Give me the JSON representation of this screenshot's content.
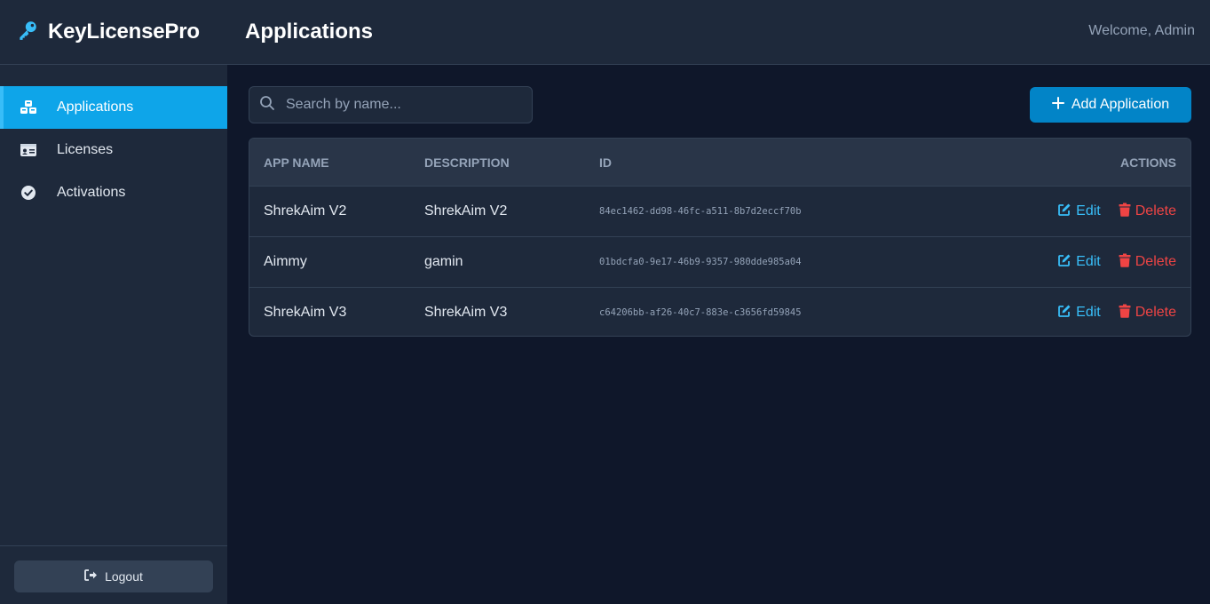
{
  "brand": {
    "name": "KeyLicensePro",
    "icon": "key-icon",
    "accent": "#38bdf8"
  },
  "header": {
    "title": "Applications",
    "welcome": "Welcome, Admin"
  },
  "sidebar": {
    "items": [
      {
        "label": "Applications",
        "icon": "cubes-icon",
        "active": true
      },
      {
        "label": "Licenses",
        "icon": "id-card-icon",
        "active": false
      },
      {
        "label": "Activations",
        "icon": "check-circle-icon",
        "active": false
      }
    ],
    "logout_label": "Logout"
  },
  "search": {
    "placeholder": "Search by name...",
    "value": ""
  },
  "toolbar": {
    "add_label": "Add Application"
  },
  "table": {
    "headers": {
      "name": "APP NAME",
      "description": "DESCRIPTION",
      "id": "ID",
      "actions": "ACTIONS"
    },
    "rows": [
      {
        "name": "ShrekAim V2",
        "description": "ShrekAim V2",
        "id": "84ec1462-dd98-46fc-a511-8b7d2eccf70b",
        "edit": "Edit",
        "delete": "Delete"
      },
      {
        "name": "Aimmy",
        "description": "gamin",
        "id": "01bdcfa0-9e17-46b9-9357-980dde985a04",
        "edit": "Edit",
        "delete": "Delete"
      },
      {
        "name": "ShrekAim V3",
        "description": "ShrekAim V3",
        "id": "c64206bb-af26-40c7-883e-c3656fd59845",
        "edit": "Edit",
        "delete": "Delete"
      }
    ]
  },
  "colors": {
    "primary": "#0284c7",
    "active_nav": "#0ea5e9",
    "danger": "#ef4444",
    "link": "#38bdf8"
  }
}
